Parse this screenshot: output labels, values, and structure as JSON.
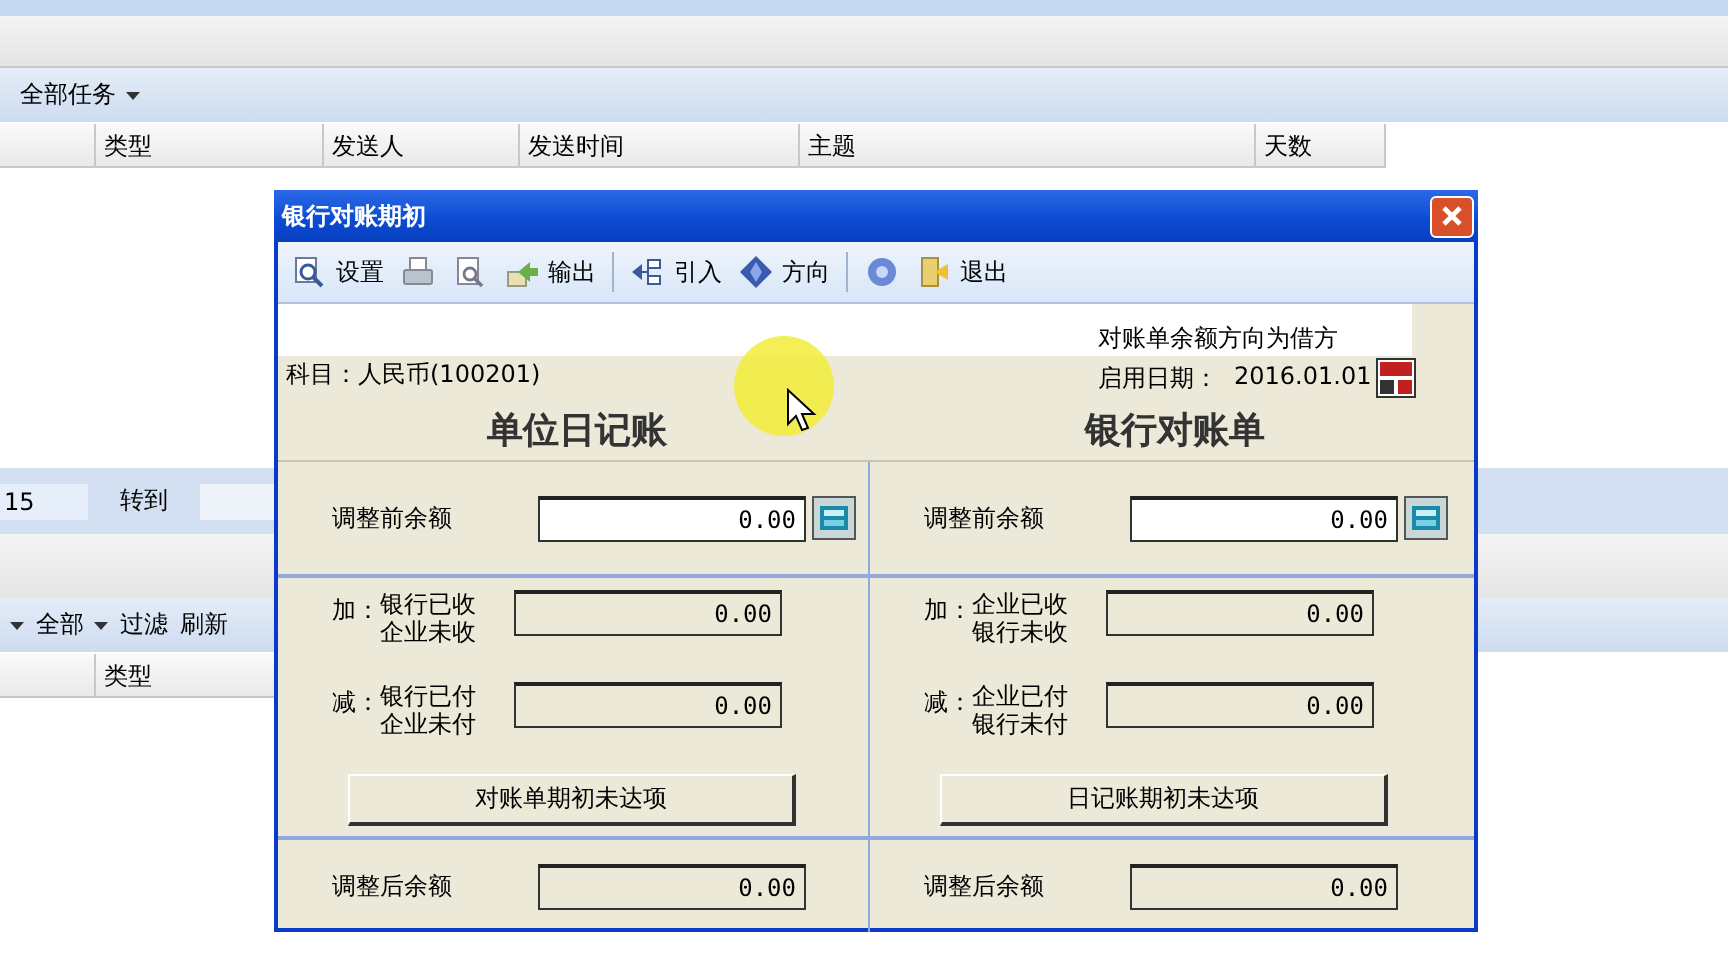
{
  "top_toolbar": {
    "task_filter": "全部任务"
  },
  "top_columns": [
    "类型",
    "发送人",
    "发送时间",
    "主题",
    "天数"
  ],
  "pager": {
    "page": "15",
    "goto_label": "转到"
  },
  "lower_toolbar": [
    "全部",
    "过滤",
    "刷新"
  ],
  "lower_columns": [
    "类型"
  ],
  "dialog": {
    "title": "银行对账期初",
    "toolbar": [
      {
        "kind": "tool",
        "label": "设置"
      },
      {
        "kind": "tool"
      },
      {
        "kind": "tool"
      },
      {
        "kind": "tool",
        "label": "输出"
      },
      {
        "kind": "separator"
      },
      {
        "kind": "tool",
        "label": "引入"
      },
      {
        "kind": "tool",
        "label": "方向"
      },
      {
        "kind": "separator"
      },
      {
        "kind": "tool"
      },
      {
        "kind": "tool",
        "label": "退出"
      }
    ],
    "subject": "科目：人民币(100201)",
    "direction_note": "对账单余额方向为借方",
    "start_date_label": "启用日期：",
    "start_date": "2016.01.01",
    "panels": [
      {
        "heading": "单位日记账",
        "before_label": "调整前余额",
        "before_value": "0.00",
        "before_disabled": false,
        "add_prefix": "加：",
        "add_lines": [
          "银行已收",
          "企业未收"
        ],
        "add_value": "0.00",
        "add_disabled": true,
        "sub_prefix": "减：",
        "sub_lines": [
          "银行已付",
          "企业未付"
        ],
        "sub_value": "0.00",
        "sub_disabled": true,
        "button": "对账单期初未达项",
        "after_label": "调整后余额",
        "after_value": "0.00",
        "after_disabled": true
      },
      {
        "heading": "银行对账单",
        "before_label": "调整前余额",
        "before_value": "0.00",
        "before_disabled": false,
        "add_prefix": "加：",
        "add_lines": [
          "企业已收",
          "银行未收"
        ],
        "add_value": "0.00",
        "add_disabled": true,
        "sub_prefix": "减：",
        "sub_lines": [
          "企业已付",
          "银行未付"
        ],
        "sub_value": "0.00",
        "sub_disabled": true,
        "button": "日记账期初未达项",
        "after_label": "调整后余额",
        "after_value": "0.00",
        "after_disabled": true
      }
    ]
  }
}
